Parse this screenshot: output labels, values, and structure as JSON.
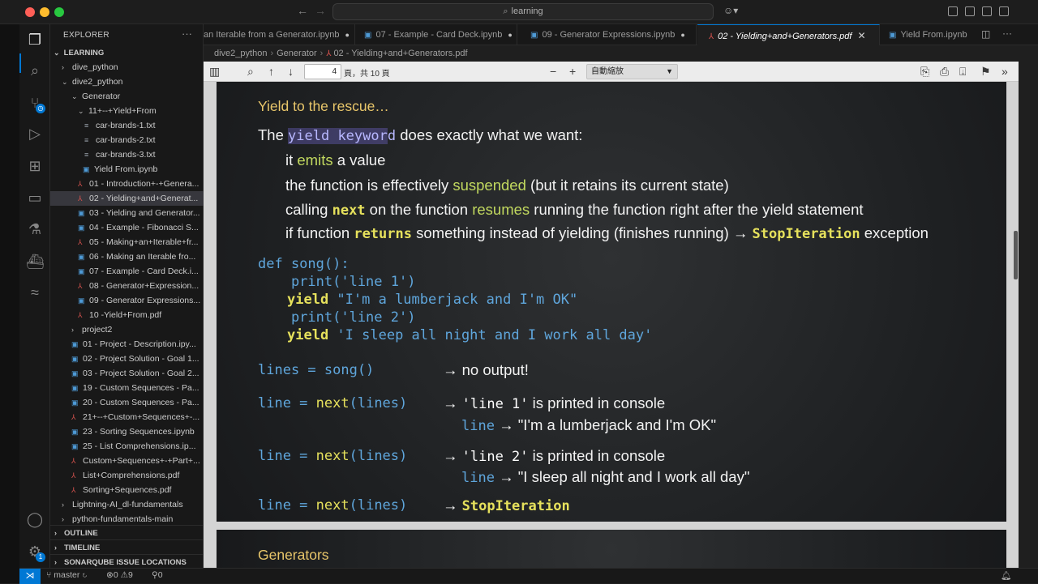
{
  "window": {
    "search_text": "learning"
  },
  "tabs": [
    {
      "label": "an Iterable from a Generator.ipynb",
      "icon": "notebook",
      "modified": "●"
    },
    {
      "label": "07 - Example - Card Deck.ipynb",
      "icon": "notebook",
      "modified": "●"
    },
    {
      "label": "09 - Generator Expressions.ipynb",
      "icon": "notebook",
      "modified": "●"
    },
    {
      "label": "02 - Yielding+and+Generators.pdf",
      "icon": "pdf",
      "close": "✕"
    },
    {
      "label": "Yield From.ipynb",
      "icon": "notebook"
    }
  ],
  "breadcrumb": [
    "dive2_python",
    "Generator",
    "02 - Yielding+and+Generators.pdf"
  ],
  "explorer": {
    "title": "EXPLORER",
    "root": "LEARNING",
    "items": [
      {
        "label": "dive_python",
        "type": "folder",
        "chev": "›"
      },
      {
        "label": "dive2_python",
        "type": "folder",
        "chev": "⌄"
      },
      {
        "label": "Generator",
        "type": "folder",
        "chev": "⌄"
      },
      {
        "label": "11+--+Yield+From",
        "type": "folder",
        "chev": "⌄"
      },
      {
        "label": "car-brands-1.txt",
        "type": "txt"
      },
      {
        "label": "car-brands-2.txt",
        "type": "txt"
      },
      {
        "label": "car-brands-3.txt",
        "type": "txt"
      },
      {
        "label": "Yield From.ipynb",
        "type": "nb"
      },
      {
        "label": "01 - Introduction+-+Genera...",
        "type": "pdf"
      },
      {
        "label": "02 - Yielding+and+Generat...",
        "type": "pdf"
      },
      {
        "label": "03 - Yielding and Generator...",
        "type": "nb"
      },
      {
        "label": "04 - Example - Fibonacci S...",
        "type": "nb"
      },
      {
        "label": "05 - Making+an+Iterable+fr...",
        "type": "pdf"
      },
      {
        "label": "06 - Making an Iterable fro...",
        "type": "nb"
      },
      {
        "label": "07 - Example - Card Deck.i...",
        "type": "nb"
      },
      {
        "label": "08 - Generator+Expression...",
        "type": "pdf"
      },
      {
        "label": "09 - Generator Expressions...",
        "type": "nb"
      },
      {
        "label": "10 -Yield+From.pdf",
        "type": "pdf"
      },
      {
        "label": "project2",
        "type": "folder",
        "chev": "›"
      },
      {
        "label": "01 - Project - Description.ipy...",
        "type": "nb"
      },
      {
        "label": "02 - Project Solution - Goal 1...",
        "type": "nb"
      },
      {
        "label": "03 - Project Solution - Goal 2...",
        "type": "nb"
      },
      {
        "label": "19 - Custom Sequences - Pa...",
        "type": "nb"
      },
      {
        "label": "20 - Custom Sequences - Pa...",
        "type": "nb"
      },
      {
        "label": "21+--+Custom+Sequences+-...",
        "type": "pdf"
      },
      {
        "label": "23 - Sorting Sequences.ipynb",
        "type": "nb"
      },
      {
        "label": "25 - List Comprehensions.ip...",
        "type": "nb"
      },
      {
        "label": "Custom+Sequences+-+Part+...",
        "type": "pdf"
      },
      {
        "label": "List+Comprehensions.pdf",
        "type": "pdf"
      },
      {
        "label": "Sorting+Sequences.pdf",
        "type": "pdf"
      },
      {
        "label": "Lightning-AI_dl-fundamentals",
        "type": "folder",
        "chev": "›"
      },
      {
        "label": "python-fundamentals-main",
        "type": "folder",
        "chev": "›"
      }
    ],
    "sections": [
      "OUTLINE",
      "TIMELINE",
      "SONARQUBE ISSUE LOCATIONS"
    ]
  },
  "pdf_toolbar": {
    "page_value": "4",
    "page_total": "頁，共 10 頁",
    "zoom": "自動縮放"
  },
  "slide": {
    "title": "Yield to the rescue…",
    "intro_pre": "The ",
    "intro_kw": "yield keywor",
    "intro_kw2": "d",
    "intro_post": " does exactly what we want:",
    "b1_pre": "it ",
    "b1_kw": "emits",
    "b1_post": " a value",
    "b2_pre": "the function is effectively ",
    "b2_kw": "suspended",
    "b2_post": " (but it retains its current state)",
    "b3_pre": "calling ",
    "b3_code": "next",
    "b3_mid": " on the function ",
    "b3_kw": "resumes",
    "b3_post": " running the function right after the yield statement",
    "b4_pre": "if function ",
    "b4_code": "returns",
    "b4_mid": " something instead of yielding (finishes running) ",
    "b4_arrow": "→",
    "b4_code2": "StopIteration",
    "b4_post": " exception",
    "code1": "def song():",
    "code2": "    print('line 1')",
    "code3_kw": "yield",
    "code3_str": " \"I'm a lumberjack and I'm OK\"",
    "code4": "    print('line 2')",
    "code5_kw": "yield",
    "code5_str": " 'I sleep all night and I work all day'",
    "r1_code": "lines = song()",
    "r1_result": "→ no output!",
    "r2_code_a": "line = ",
    "r2_code_b": "next",
    "r2_code_c": "(lines)",
    "r2_arrow": "→ ",
    "r2_code2": "'line 1'",
    "r2_result": " is printed in console",
    "r2b_code": "line",
    "r2b_result": " → \"I'm a lumberjack and I'm OK\"",
    "r3_code_a": "line = ",
    "r3_code_b": "next",
    "r3_code_c": "(lines)",
    "r3_arrow": "→ ",
    "r3_code2": "'line 2'",
    "r3_result": " is printed in console",
    "r3b_code": "line",
    "r3b_result": " → \"I sleep all night and I work all day\"",
    "r4_code_a": "line = ",
    "r4_code_b": "next",
    "r4_code_c": "(lines)",
    "r4_arrow": "→ ",
    "r4_code2": "StopIteration"
  },
  "slide2": {
    "title": "Generators"
  },
  "statusbar": {
    "branch": "master",
    "errors": "0",
    "warnings": "9",
    "ports": "0"
  }
}
